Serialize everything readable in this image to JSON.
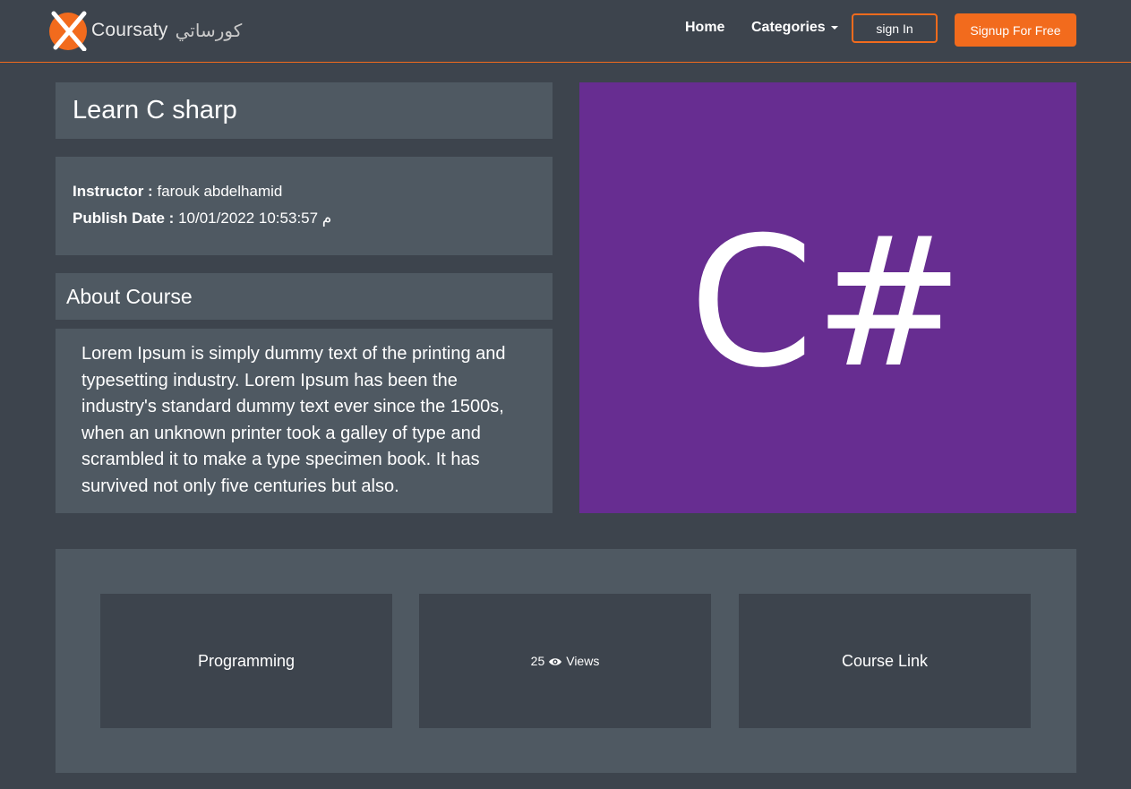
{
  "navbar": {
    "logo_text": "Coursaty",
    "logo_arabic": "كورساتي",
    "home_label": "Home",
    "categories_label": "Categories",
    "signin_label": "sign In",
    "signup_label": "Signup For Free"
  },
  "course": {
    "title": "Learn C sharp",
    "instructor_label": "Instructor :",
    "instructor_value": "farouk abdelhamid",
    "publish_label": "Publish Date :",
    "publish_value": "10/01/2022 10:53:57 م",
    "about_title": "About Course",
    "about_text": "Lorem Ipsum is simply dummy text of the printing and typesetting industry. Lorem Ipsum has been the industry's standard dummy text ever since the 1500s, when an unknown printer took a galley of type and scrambled it to make a type specimen book. It has survived not only five centuries but also.",
    "image_text": "C#"
  },
  "stats": {
    "category": "Programming",
    "views_count": "25",
    "views_label": "Views",
    "link_label": "Course Link"
  },
  "colors": {
    "background": "#3d444d",
    "panel": "#4f5962",
    "accent": "#f26b1d",
    "image_bg": "#672d91"
  },
  "icons": {
    "logo": "coursaty-logo-icon",
    "caret": "caret-down-icon",
    "views": "eye-icon"
  }
}
